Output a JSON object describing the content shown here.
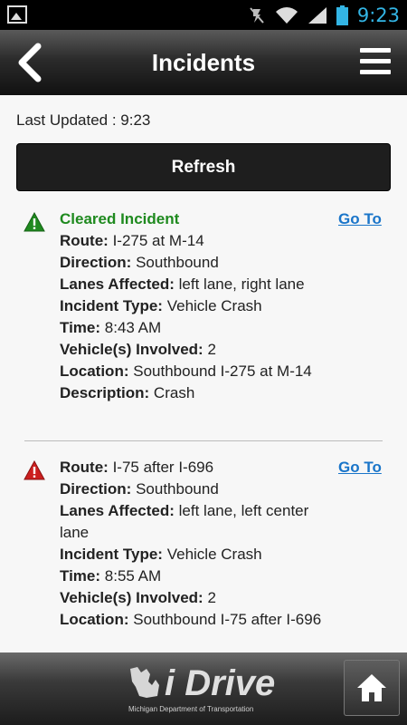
{
  "status_bar": {
    "time": "9:23"
  },
  "app_bar": {
    "title": "Incidents"
  },
  "content": {
    "last_updated_label": "Last Updated : 9:23",
    "refresh_label": "Refresh",
    "incidents": [
      {
        "status": "Cleared Incident",
        "goto_label": "Go To",
        "icon_color": "#1f8a1f",
        "fields": [
          {
            "label": "Route:",
            "value": "I-275 at M-14"
          },
          {
            "label": "Direction:",
            "value": "Southbound"
          },
          {
            "label": "Lanes Affected:",
            "value": "left lane, right lane"
          },
          {
            "label": "Incident Type:",
            "value": "Vehicle Crash"
          },
          {
            "label": "Time:",
            "value": "8:43 AM"
          },
          {
            "label": "Vehicle(s) Involved:",
            "value": "2"
          },
          {
            "label": "Location:",
            "value": "Southbound I-275 at M-14"
          },
          {
            "label": "Description:",
            "value": "Crash"
          }
        ]
      },
      {
        "status": "",
        "goto_label": "Go To",
        "icon_color": "#cc1f1f",
        "fields": [
          {
            "label": "Route:",
            "value": "I-75 after I-696"
          },
          {
            "label": "Direction:",
            "value": "Southbound"
          },
          {
            "label": "Lanes Affected:",
            "value": "left lane, left center lane"
          },
          {
            "label": "Incident Type:",
            "value": "Vehicle Crash"
          },
          {
            "label": "Time:",
            "value": "8:55 AM"
          },
          {
            "label": "Vehicle(s) Involved:",
            "value": "2"
          },
          {
            "label": "Location:",
            "value": "Southbound I-75 after I-696"
          }
        ]
      }
    ]
  },
  "footer": {
    "logo_text": "i Drive",
    "logo_subtitle": "Michigan Department of Transportation"
  }
}
